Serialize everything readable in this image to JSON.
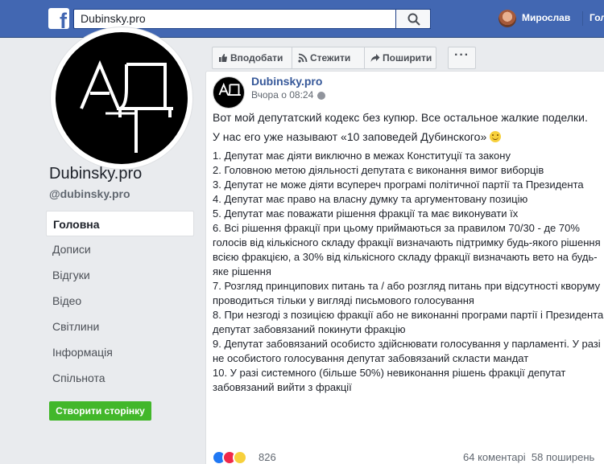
{
  "topbar": {
    "logo_letter": "f",
    "search_value": "Dubinsky.pro",
    "user_name": "Мирослав",
    "home_label": "Головна"
  },
  "page": {
    "avatar_text": "АД",
    "name": "Dubinsky.pro",
    "handle": "@dubinsky.pro"
  },
  "nav": {
    "items": [
      {
        "label": "Головна",
        "active": true
      },
      {
        "label": "Дописи"
      },
      {
        "label": "Відгуки"
      },
      {
        "label": "Відео"
      },
      {
        "label": "Світлини"
      },
      {
        "label": "Інформація"
      },
      {
        "label": "Спільнота"
      }
    ],
    "create_page_label": "Створити сторінку"
  },
  "actions": {
    "like_label": "Вподобати",
    "follow_label": "Стежити",
    "share_label": "Поширити",
    "more_label": "···"
  },
  "post": {
    "author": "Dubinsky.pro",
    "time": "Вчора о 08:24 · ",
    "intro": "Вот мой депутатский кодекс без купюр. Все остальное жалкие поделки.",
    "intro2": "У нас его уже называют «10 заповедей Дубинского» ",
    "items": [
      "1. Депутат має діяти виключно в межах Конституції та закону",
      "2. Головною метою діяльності депутата є виконання вимог виборців",
      "3. Депутат не може діяти всупереч програмі політичної партії та Президента",
      "4. Депутат має право на власну думку та аргументовану позицію",
      "5. Депутат має поважати рішення фракції та має виконувати їх",
      "6. Всі рішення фракції при цьому приймаються за правилом 70/30 - де 70% голосів від кількісного складу фракції визначають підтримку будь-якого рішення всією фракцією, а 30% від кількісного складу фракції визначають вето на будь-яке рішення",
      "7. Розгляд принципових питань та / або розгляд питань при відсутності кворуму проводиться тільки у вигляді письмового голосування",
      "8. При незгоді з позицією фракції або не виконанні програми партії і Президента депутат забовязаний покинути фракцію",
      "9. Депутат забовязаний особисто здійснювати голосування у парламенті. У разі не особистого голосування депутат забовязаний скласти мандат",
      "10. У разі системного (більше 50%) невиконання рішень фракції депутат забовязаний вийти з фракції"
    ],
    "reaction_count": "826",
    "comments": "64 коментарі",
    "shares": "58 поширень"
  },
  "colors": {
    "fb_blue": "#4267b2",
    "link": "#365899",
    "green": "#42b72a"
  }
}
